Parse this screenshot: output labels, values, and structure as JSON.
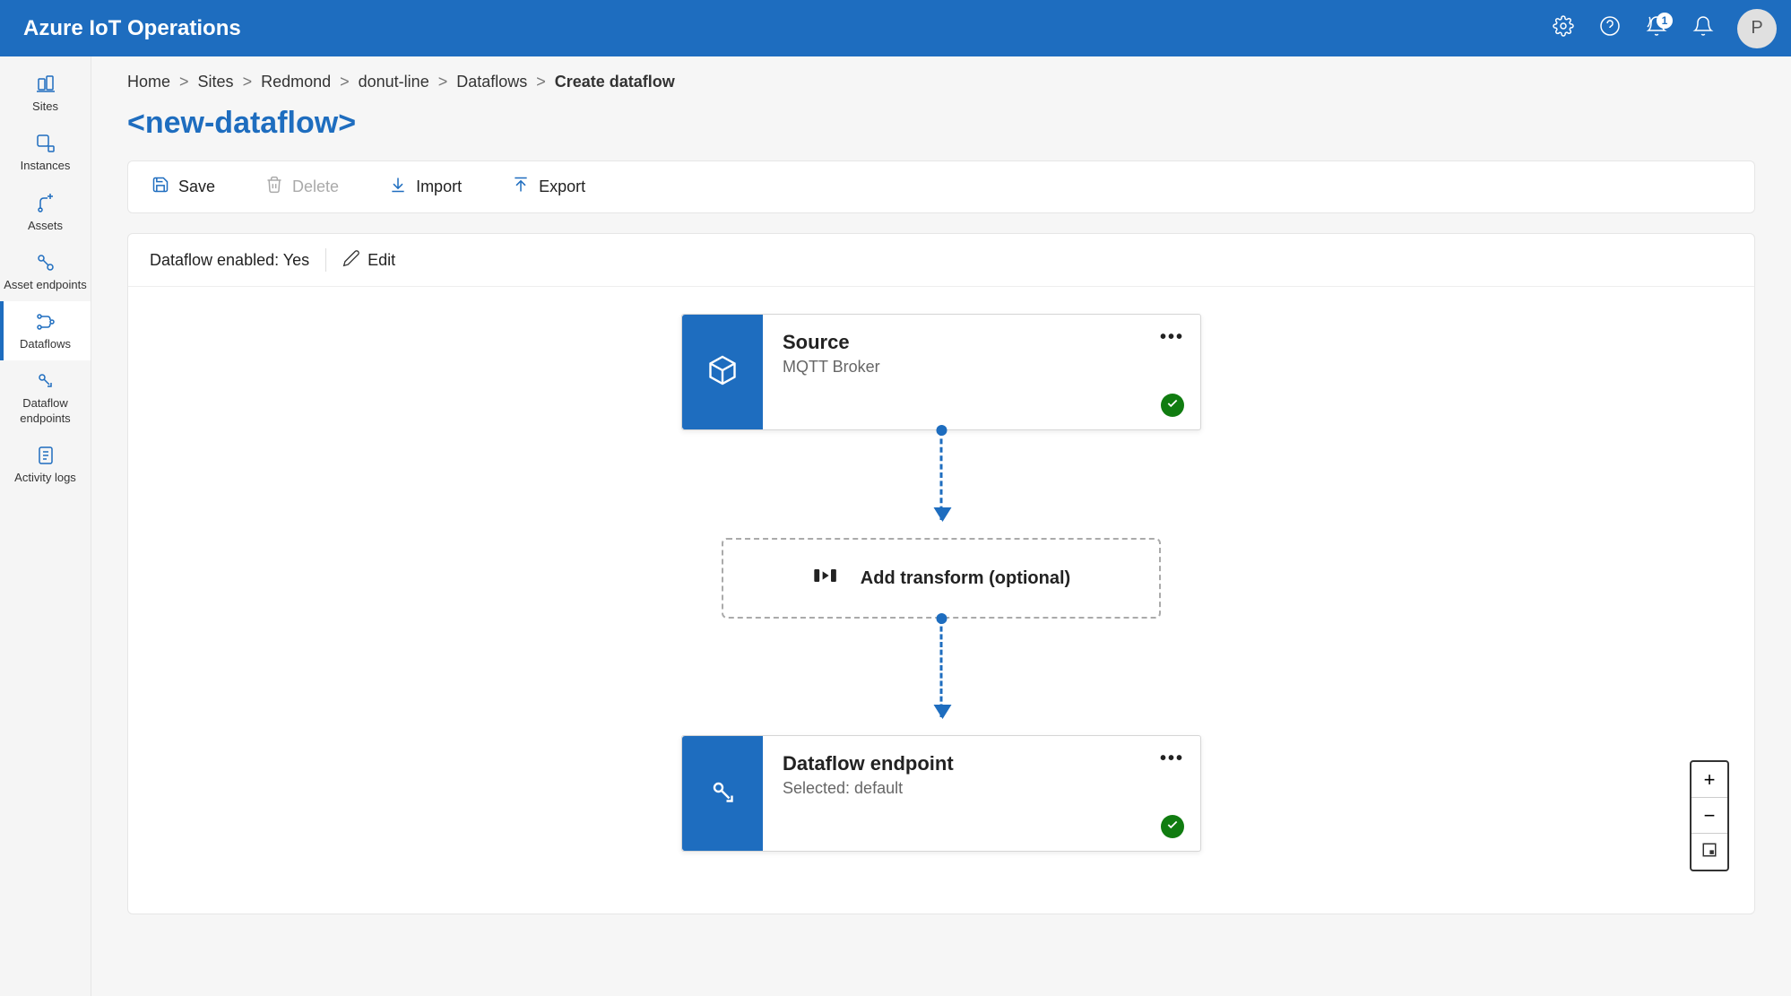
{
  "header": {
    "title": "Azure IoT Operations",
    "notification_badge": "1",
    "avatar_initial": "P"
  },
  "sidebar": {
    "items": [
      {
        "label": "Sites"
      },
      {
        "label": "Instances"
      },
      {
        "label": "Assets"
      },
      {
        "label": "Asset endpoints"
      },
      {
        "label": "Dataflows"
      },
      {
        "label": "Dataflow endpoints"
      },
      {
        "label": "Activity logs"
      }
    ]
  },
  "breadcrumb": {
    "items": [
      {
        "label": "Home"
      },
      {
        "label": "Sites"
      },
      {
        "label": "Redmond"
      },
      {
        "label": "donut-line"
      },
      {
        "label": "Dataflows"
      },
      {
        "label": "Create dataflow",
        "current": true
      }
    ]
  },
  "page_title": "<new-dataflow>",
  "toolbar": {
    "save_label": "Save",
    "delete_label": "Delete",
    "import_label": "Import",
    "export_label": "Export"
  },
  "status": {
    "enabled_label": "Dataflow enabled: Yes",
    "edit_label": "Edit"
  },
  "flow": {
    "source": {
      "title": "Source",
      "subtitle": "MQTT Broker"
    },
    "transform": {
      "label": "Add transform (optional)"
    },
    "endpoint": {
      "title": "Dataflow endpoint",
      "subtitle": "Selected: default"
    }
  }
}
